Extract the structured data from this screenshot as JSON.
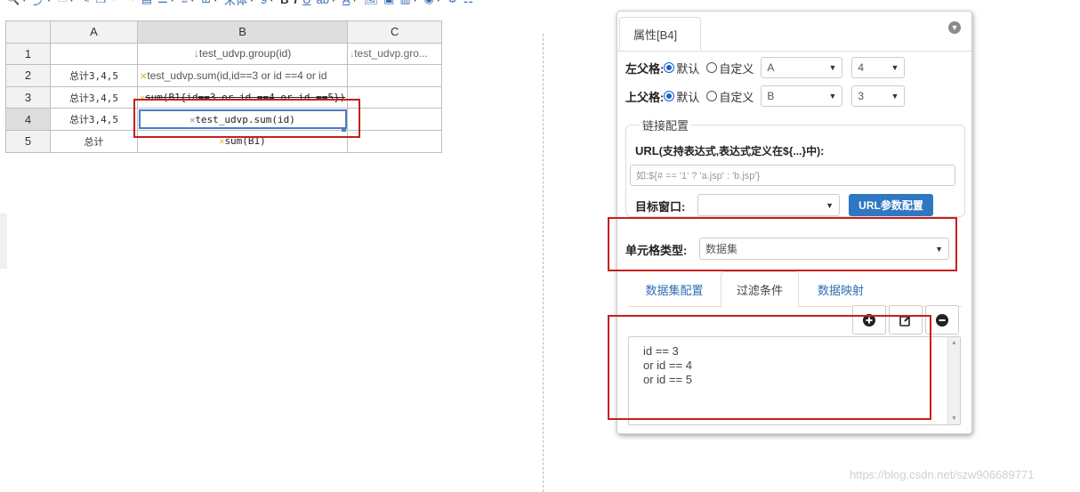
{
  "toolbar": {
    "font_name": "宋体",
    "font_size": "9",
    "bold": "B",
    "italic": "I",
    "underline": "U",
    "text_color": "A"
  },
  "grid": {
    "columns": [
      "A",
      "B",
      "C"
    ],
    "rows": [
      {
        "num": "1",
        "a": "",
        "b": "test_udvp.group(id)",
        "b_marker": "↓",
        "c": "test_udvp.gro...",
        "c_marker": "↓"
      },
      {
        "num": "2",
        "a": "总计3,4,5",
        "b": "test_udvp.sum(id,id==3 or id ==4 or id",
        "b_marker": "✕",
        "c": ""
      },
      {
        "num": "3",
        "a": "总计3,4,5",
        "b": "sum(B1{id==3 or id ==4 or id ==5})",
        "b_marker": "✕",
        "c": ""
      },
      {
        "num": "4",
        "a": "总计3,4,5",
        "b": "test_udvp.sum(id)",
        "b_marker": "✕",
        "c": ""
      },
      {
        "num": "5",
        "a": "总计",
        "b": "sum(B1)",
        "b_marker": "✕",
        "c": ""
      }
    ]
  },
  "panel": {
    "tab_title": "属性[B4]",
    "left_parent": {
      "label": "左父格:",
      "opt_default": "默认",
      "opt_custom": "自定义",
      "col": "A",
      "row": "4"
    },
    "top_parent": {
      "label": "上父格:",
      "opt_default": "默认",
      "opt_custom": "自定义",
      "col": "B",
      "row": "3"
    },
    "link_config": {
      "legend": "链接配置",
      "url_label": "URL",
      "url_hint": "(支持表达式,表达式定义在${...}中)",
      "url_colon": ":",
      "url_placeholder": "如:${# == '1' ? 'a.jsp' : 'b.jsp'}",
      "target_label": "目标窗口:",
      "target_value": "",
      "url_params_button": "URL参数配置"
    },
    "cell_type": {
      "label": "单元格类型:",
      "value": "数据集"
    },
    "sub_tabs": [
      {
        "label": "数据集配置",
        "active": false
      },
      {
        "label": "过滤条件",
        "active": true
      },
      {
        "label": "数据映射",
        "active": false
      }
    ],
    "filter_lines": [
      "id == 3",
      "or id == 4",
      "or id == 5"
    ]
  },
  "watermark": "https://blog.csdn.net/szw906689771",
  "colors": {
    "highlight_red": "#c81e1e",
    "primary_blue": "#2f77c2",
    "selection_blue": "#4a7cc9"
  }
}
